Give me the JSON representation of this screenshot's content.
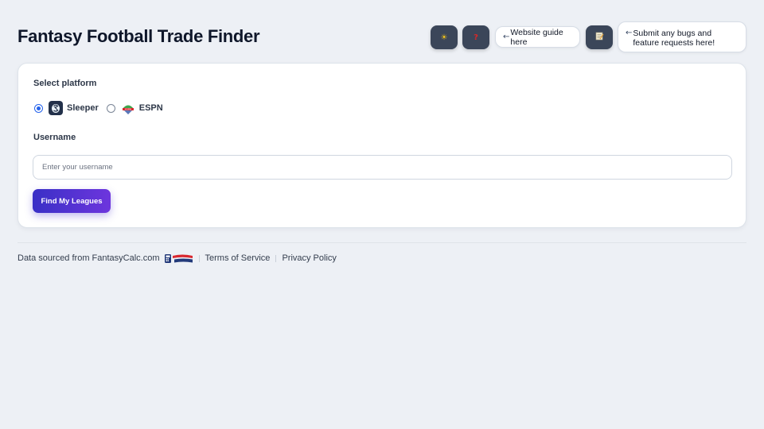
{
  "header": {
    "title": "Fantasy Football Trade Finder",
    "theme_toggle_icon": "sun-icon",
    "help_icon": "question-icon",
    "feedback_icon": "memo-icon",
    "guide_tooltip": "Website guide here",
    "bugs_tooltip": "Submit any bugs and feature requests here!"
  },
  "form": {
    "platform_label": "Select platform",
    "platforms": [
      {
        "label": "Sleeper",
        "icon": "sleeper-logo-icon",
        "selected": true
      },
      {
        "label": "ESPN",
        "icon": "espn-logo-icon",
        "selected": false
      }
    ],
    "username_label": "Username",
    "username_placeholder": "Enter your username",
    "username_value": "",
    "submit_label": "Find My Leagues"
  },
  "footer": {
    "source_text": "Data sourced from FantasyCalc.com",
    "source_logo": "fantasycalc-logo-icon",
    "links": [
      "Terms of Service",
      "Privacy Policy"
    ]
  },
  "colors": {
    "background": "#edf0f5",
    "header_button": "#3b4659",
    "accent_start": "#3a30c6",
    "accent_end": "#6d35dd",
    "radio_selected": "#2563eb"
  }
}
